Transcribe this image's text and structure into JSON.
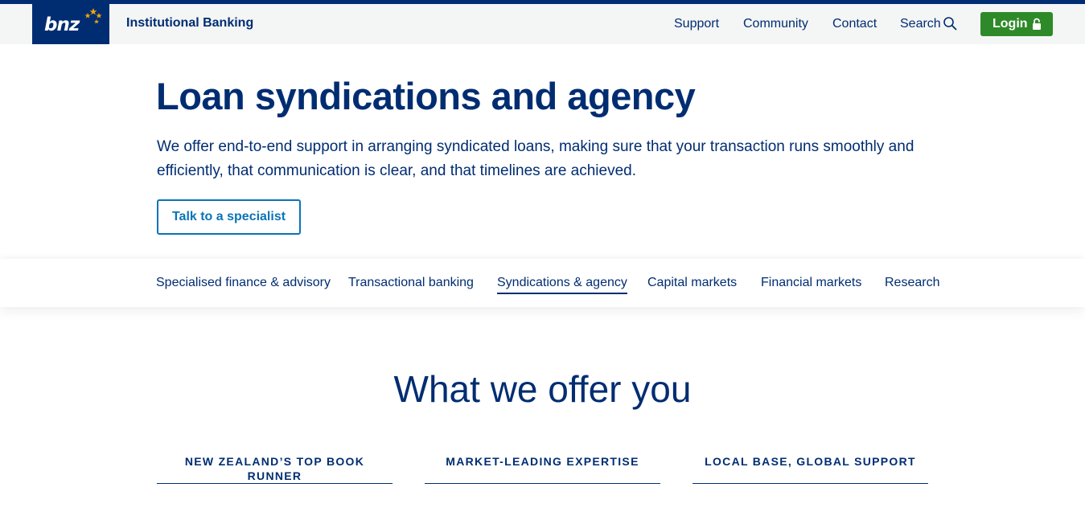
{
  "header": {
    "logo_text": "bnz",
    "brand_title": "Institutional Banking",
    "nav": {
      "support": "Support",
      "community": "Community",
      "contact": "Contact",
      "search": "Search"
    },
    "login_label": "Login",
    "icons": [
      "logo-stars-icon",
      "search-icon",
      "lock-icon"
    ]
  },
  "hero": {
    "title": "Loan syndications and agency",
    "intro": "We offer end-to-end support in arranging syndicated loans, making sure that your transaction runs smoothly and efficiently, that communication is clear, and that timelines are achieved.",
    "cta_label": "Talk to a specialist"
  },
  "subnav": {
    "items": [
      "Specialised finance & advisory",
      "Transactional banking",
      "Syndications & agency",
      "Capital markets",
      "Financial markets",
      "Research"
    ],
    "active": "Syndications & agency"
  },
  "offer": {
    "title": "What we offer you",
    "cards": [
      "NEW ZEALAND’S TOP BOOK RUNNER",
      "MARKET-LEADING EXPERTISE",
      "LOCAL BASE, GLOBAL SUPPORT"
    ]
  },
  "colors": {
    "brand_navy": "#002d72",
    "login_green": "#2e8a28",
    "cta_blue": "#0b74b8",
    "star_gold": "#f5a800"
  }
}
